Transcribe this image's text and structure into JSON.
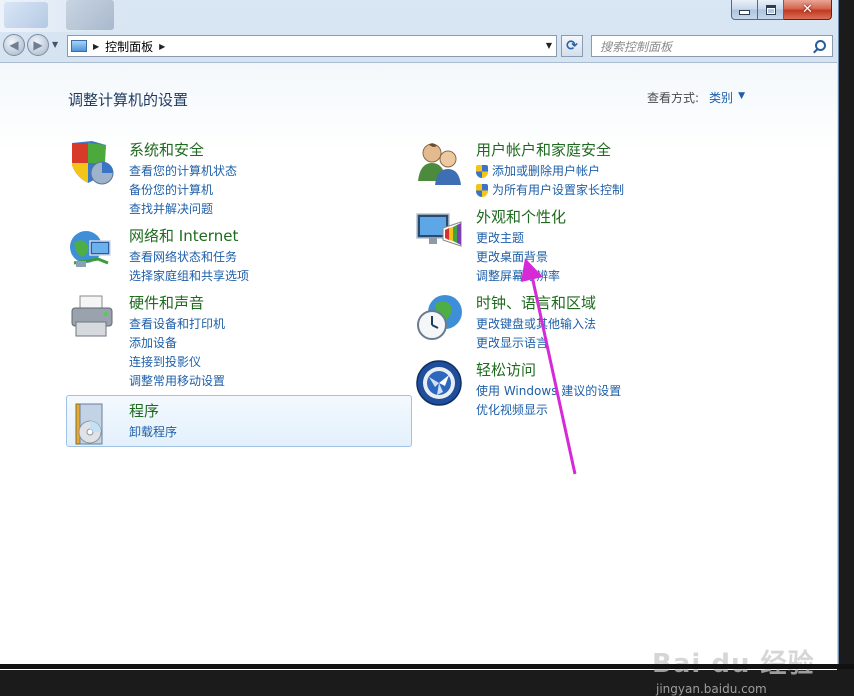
{
  "window": {
    "minimize_icon": "minimize-icon",
    "maximize_icon": "maximize-icon",
    "close_glyph": "✕"
  },
  "navigation": {
    "back_glyph": "◀",
    "forward_glyph": "▶",
    "breadcrumb": [
      "控制面板"
    ],
    "refresh_glyph": "⟳"
  },
  "search": {
    "placeholder": "搜索控制面板"
  },
  "header": {
    "title": "调整计算机的设置",
    "view_by_label": "查看方式:",
    "view_by_value": "类别"
  },
  "categories_left": [
    {
      "title": "系统和安全",
      "icon": "shield-pie-icon",
      "links": [
        "查看您的计算机状态",
        "备份您的计算机",
        "查找并解决问题"
      ]
    },
    {
      "title": "网络和 Internet",
      "icon": "network-globe-icon",
      "links": [
        "查看网络状态和任务",
        "选择家庭组和共享选项"
      ]
    },
    {
      "title": "硬件和声音",
      "icon": "printer-icon",
      "links": [
        "查看设备和打印机",
        "添加设备",
        "连接到投影仪",
        "调整常用移动设置"
      ]
    },
    {
      "title": "程序",
      "icon": "programs-icon",
      "links": [
        "卸载程序"
      ]
    }
  ],
  "categories_right": [
    {
      "title": "用户帐户和家庭安全",
      "icon": "users-icon",
      "links": [
        "添加或删除用户帐户",
        "为所有用户设置家长控制"
      ]
    },
    {
      "title": "外观和个性化",
      "icon": "monitor-palette-icon",
      "links": [
        "更改主题",
        "更改桌面背景",
        "调整屏幕分辨率"
      ]
    },
    {
      "title": "时钟、语言和区域",
      "icon": "clock-globe-icon",
      "links": [
        "更改键盘或其他输入法",
        "更改显示语言"
      ]
    },
    {
      "title": "轻松访问",
      "icon": "ease-of-access-icon",
      "links": [
        "使用 Windows 建议的设置",
        "优化视频显示"
      ]
    }
  ],
  "colors": {
    "category_title": "#1e6a1e",
    "link": "#1e5fa8",
    "annotation_arrow": "#d62ad6"
  },
  "watermark": {
    "brand": "Bai du 经验",
    "url": "jingyan.baidu.com"
  }
}
